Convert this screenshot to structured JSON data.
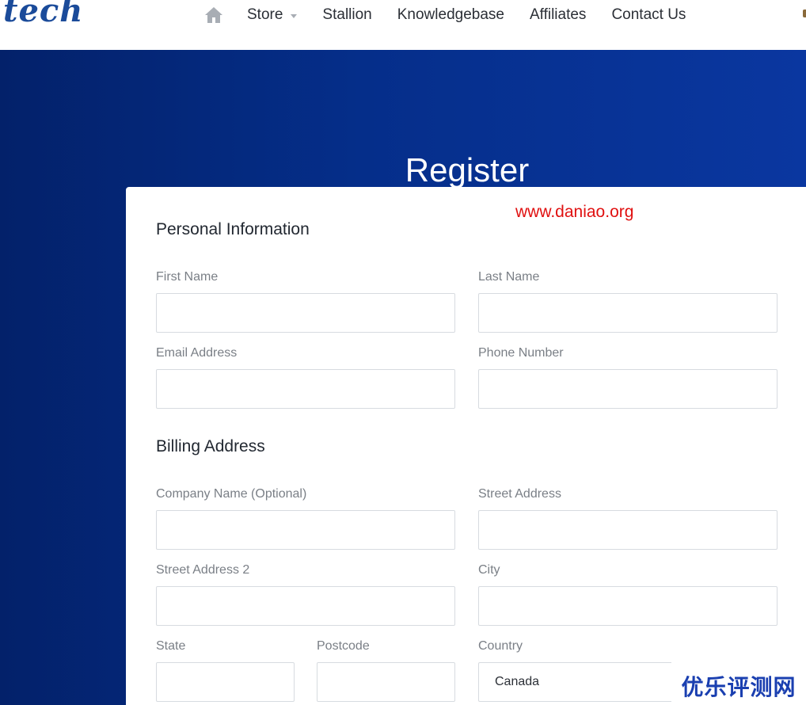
{
  "header": {
    "logo": "tech",
    "nav": {
      "home_icon": "home-icon",
      "items": [
        {
          "label": "Store",
          "has_dropdown": true
        },
        {
          "label": "Stallion"
        },
        {
          "label": "Knowledgebase"
        },
        {
          "label": "Affiliates"
        },
        {
          "label": "Contact Us"
        }
      ]
    }
  },
  "hero": {
    "title": "Register"
  },
  "watermark": "www.daniao.org",
  "personal": {
    "title": "Personal Information",
    "first_name": {
      "label": "First Name",
      "value": ""
    },
    "last_name": {
      "label": "Last Name",
      "value": ""
    },
    "email": {
      "label": "Email Address",
      "value": ""
    },
    "phone": {
      "label": "Phone Number",
      "value": ""
    }
  },
  "billing": {
    "title": "Billing Address",
    "company": {
      "label": "Company Name (Optional)",
      "value": ""
    },
    "street": {
      "label": "Street Address",
      "value": ""
    },
    "street2": {
      "label": "Street Address 2",
      "value": ""
    },
    "city": {
      "label": "City",
      "value": ""
    },
    "state": {
      "label": "State",
      "value": ""
    },
    "postcode": {
      "label": "Postcode",
      "value": ""
    },
    "country": {
      "label": "Country",
      "selected": "Canada"
    }
  },
  "corner_badge": "优乐评测网",
  "colors": {
    "hero_start": "#03216a",
    "hero_end": "#0a37a0",
    "watermark": "#e01010",
    "logo": "#1b4b9a",
    "badge": "#1a3fb0"
  }
}
